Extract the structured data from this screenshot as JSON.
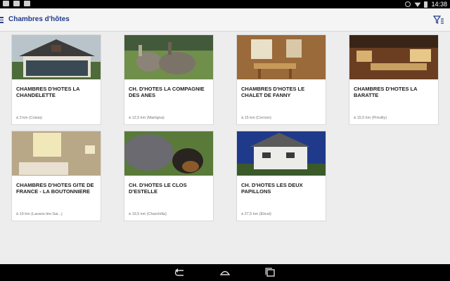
{
  "statusbar": {
    "time": "14:38"
  },
  "appbar": {
    "title": "Chambres d'hôtes"
  },
  "colors": {
    "accent": "#1f3a8a",
    "background": "#ededed"
  },
  "listings": [
    {
      "title": "CHAMBRES D'HOTES LA CHANDELETTE",
      "distance": "à 3 km (Coisia)",
      "image": "chalet-house"
    },
    {
      "title": "CH. D'HOTES LA COMPAGNIE DES ANES",
      "distance": "à 12,5 km (Martigna)",
      "image": "donkeys"
    },
    {
      "title": "CHAMBRES D'HOTES LE CHALET DE FANNY",
      "distance": "à 15 km (Cernon)",
      "image": "wooden-dining-room"
    },
    {
      "title": "CHAMBRES D'HOTES LA BARATTE",
      "distance": "à 15,5 km (Présilly)",
      "image": "rustic-dining-room"
    },
    {
      "title": "CHAMBRES D'HOTES GITE DE FRANCE - LA BOUTONNIERE",
      "distance": "à 19 km (Lavans-lès-Sai...)",
      "image": "bedroom"
    },
    {
      "title": "CH. D'HOTES LE CLOS D'ESTELLE",
      "distance": "à 19,5 km (Charchilla)",
      "image": "donkey-and-dog"
    },
    {
      "title": "CH. D'HOTES LES DEUX PAPILLONS",
      "distance": "à 27,5 km (Étival)",
      "image": "white-house"
    }
  ],
  "navbar": {
    "buttons": [
      "back-icon",
      "home-icon",
      "recent-apps-icon"
    ]
  }
}
